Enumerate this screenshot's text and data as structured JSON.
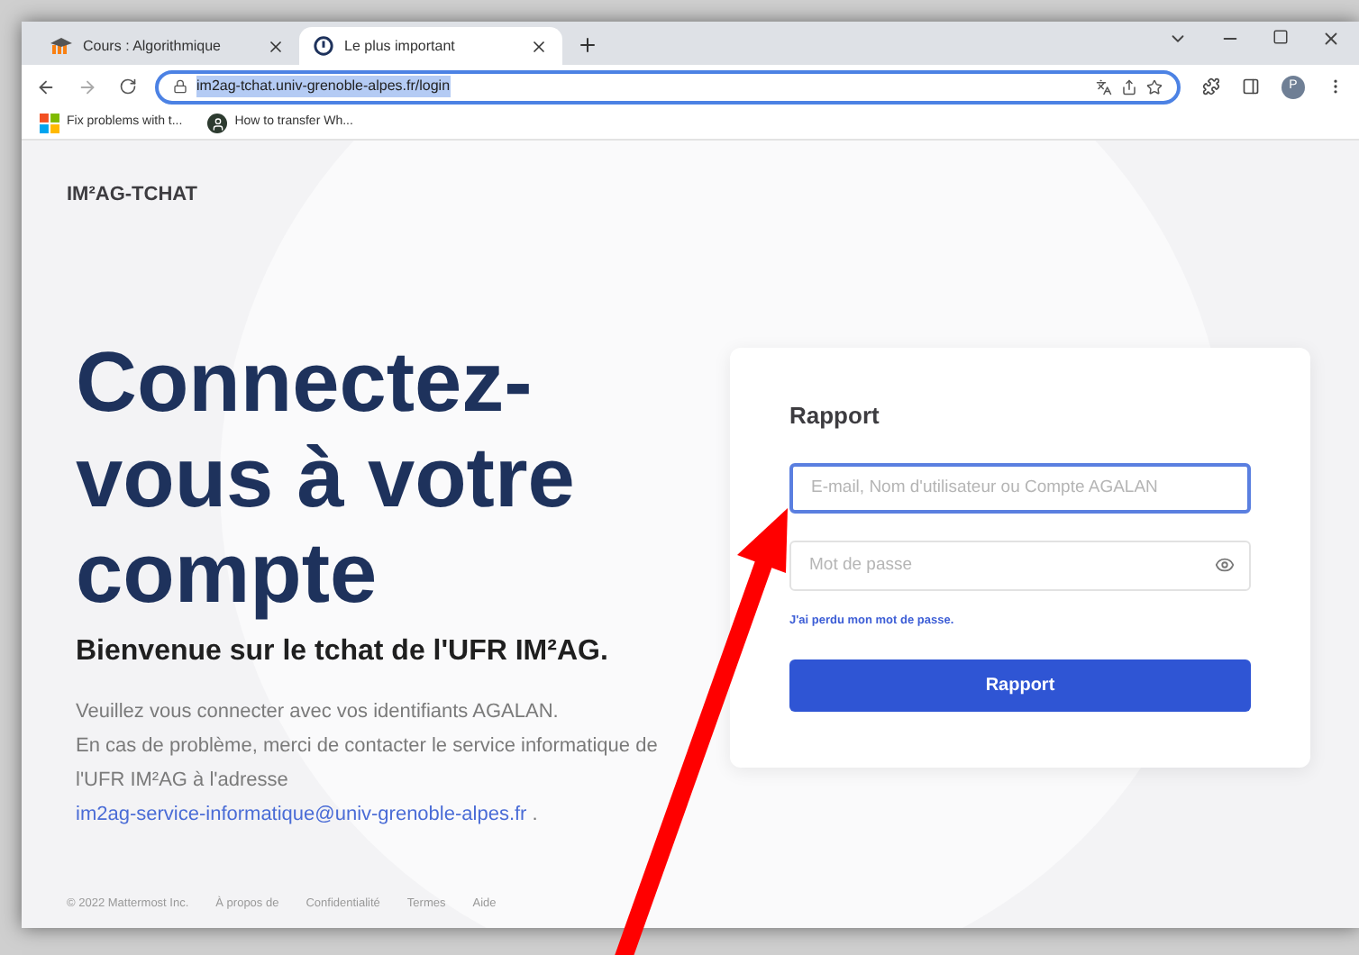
{
  "browser": {
    "tabs": [
      {
        "title": "Cours : Algorithmique",
        "selected": false,
        "kind": "moodle"
      },
      {
        "title": "Le plus important",
        "selected": true,
        "kind": "chat"
      }
    ],
    "address": "im2ag-tchat.univ-grenoble-alpes.fr/login",
    "address_selected": true,
    "profile_initial": "P",
    "bookmarks": [
      {
        "title": "Fix problems with t...",
        "kind": "windows"
      },
      {
        "title": "How to transfer Wh...",
        "kind": "avatar"
      }
    ]
  },
  "page": {
    "logo": "IM²AG-TCHAT",
    "headline": "Connectez-vous à votre compte",
    "subtitle": "Bienvenue sur le tchat de l'UFR IM²AG.",
    "paragraph": {
      "first_line": "Veuillez vous connecter avec vos identifiants AGALAN.",
      "text": "En cas de problème, merci de contacter le service informatique de l'UFR IM²AG à l'adresse",
      "link": "im2ag-service-informatique@univ-grenoble-alpes.fr",
      "after": "."
    },
    "footer": [
      "© 2022 Mattermost Inc.",
      "À propos de",
      "Confidentialité",
      "Termes",
      "Aide"
    ],
    "login": {
      "title": "Rapport",
      "fields": [
        {
          "placeholder": "E-mail, Nom d'utilisateur ou Compte AGALAN",
          "focused": true,
          "kind": "text"
        },
        {
          "placeholder": "Mot de passe",
          "focused": false,
          "kind": "password"
        }
      ],
      "forgot_link": "J'ai perdu mon mot de passe.",
      "button": "Rapport"
    }
  }
}
